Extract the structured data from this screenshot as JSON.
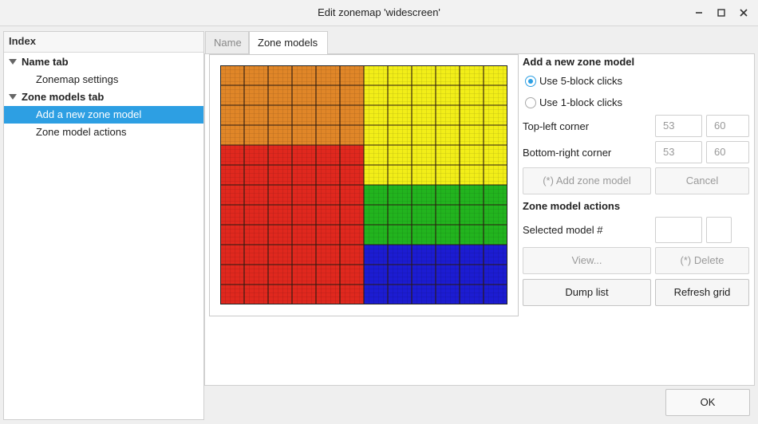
{
  "window": {
    "title": "Edit zonemap 'widescreen'"
  },
  "index": {
    "header": "Index",
    "items": [
      {
        "label": "Name tab",
        "level": 0,
        "expanded": true,
        "selected": false
      },
      {
        "label": "Zonemap settings",
        "level": 1,
        "selected": false
      },
      {
        "label": "Zone models tab",
        "level": 0,
        "expanded": true,
        "selected": false
      },
      {
        "label": "Add a new zone model",
        "level": 1,
        "selected": true
      },
      {
        "label": "Zone model actions",
        "level": 1,
        "selected": false
      }
    ]
  },
  "tabs": [
    {
      "label": "Name",
      "active": false
    },
    {
      "label": "Zone models",
      "active": true
    }
  ],
  "add_section": {
    "title": "Add a new zone model",
    "radio_5": "Use 5-block clicks",
    "radio_1": "Use 1-block clicks",
    "selected_radio": "5",
    "top_left_label": "Top-left corner",
    "top_left_x": "53",
    "top_left_y": "60",
    "bottom_right_label": "Bottom-right corner",
    "bottom_right_x": "53",
    "bottom_right_y": "60",
    "add_button": "(*) Add zone model",
    "cancel_button": "Cancel"
  },
  "actions_section": {
    "title": "Zone model actions",
    "selected_label": "Selected model #",
    "selected_value": "",
    "view_button": "View...",
    "delete_button": "(*) Delete",
    "dump_button": "Dump list",
    "refresh_button": "Refresh grid"
  },
  "footer": {
    "ok_button": "OK"
  },
  "zonemap": {
    "cols": 12,
    "rows": 12,
    "colors": {
      "orange": "#e08628",
      "yellow": "#f2ee18",
      "red": "#e0281e",
      "green": "#22b41e",
      "blue": "#1c1cd2"
    },
    "zones": [
      {
        "color": "orange",
        "col": 0,
        "row": 0,
        "cols": 6,
        "rows": 4
      },
      {
        "color": "yellow",
        "col": 6,
        "row": 0,
        "cols": 6,
        "rows": 6
      },
      {
        "color": "red",
        "col": 0,
        "row": 4,
        "cols": 6,
        "rows": 8
      },
      {
        "color": "green",
        "col": 6,
        "row": 6,
        "cols": 6,
        "rows": 3
      },
      {
        "color": "blue",
        "col": 6,
        "row": 9,
        "cols": 6,
        "rows": 3
      }
    ]
  }
}
